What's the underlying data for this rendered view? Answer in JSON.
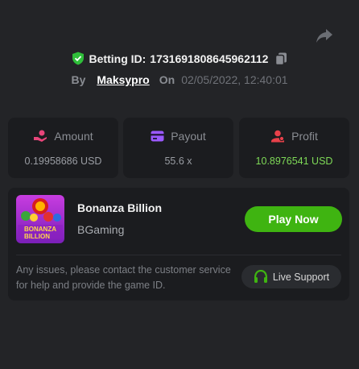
{
  "bet": {
    "id_label": "Betting ID:",
    "id_value": "1731691808645962112",
    "by_label": "By",
    "username": "Maksypro",
    "on_label": "On",
    "date": "02/05/2022, 12:40:01"
  },
  "stats": [
    {
      "label": "Amount",
      "value": "0.19958686 USD",
      "icon": "money-hand-icon",
      "icon_color": "#e8457a"
    },
    {
      "label": "Payout",
      "value": "55.6 x",
      "icon": "card-icon",
      "icon_color": "#9b59ff"
    },
    {
      "label": "Profit",
      "value": "10.8976541 USD",
      "icon": "user-profit-icon",
      "icon_color": "#e8414a",
      "value_color": "#7ed957"
    }
  ],
  "game": {
    "title": "Bonanza Billion",
    "provider": "BGaming",
    "thumb_text_1": "BONANZA",
    "thumb_text_2": "BILLION",
    "play_label": "Play Now",
    "help_text": "Any issues, please contact the customer service for help and provide the game ID.",
    "support_label": "Live Support"
  },
  "colors": {
    "background": "#232427",
    "card": "#1b1c1f",
    "accent_green": "#3fb411",
    "verified": "#2fbf3a"
  }
}
